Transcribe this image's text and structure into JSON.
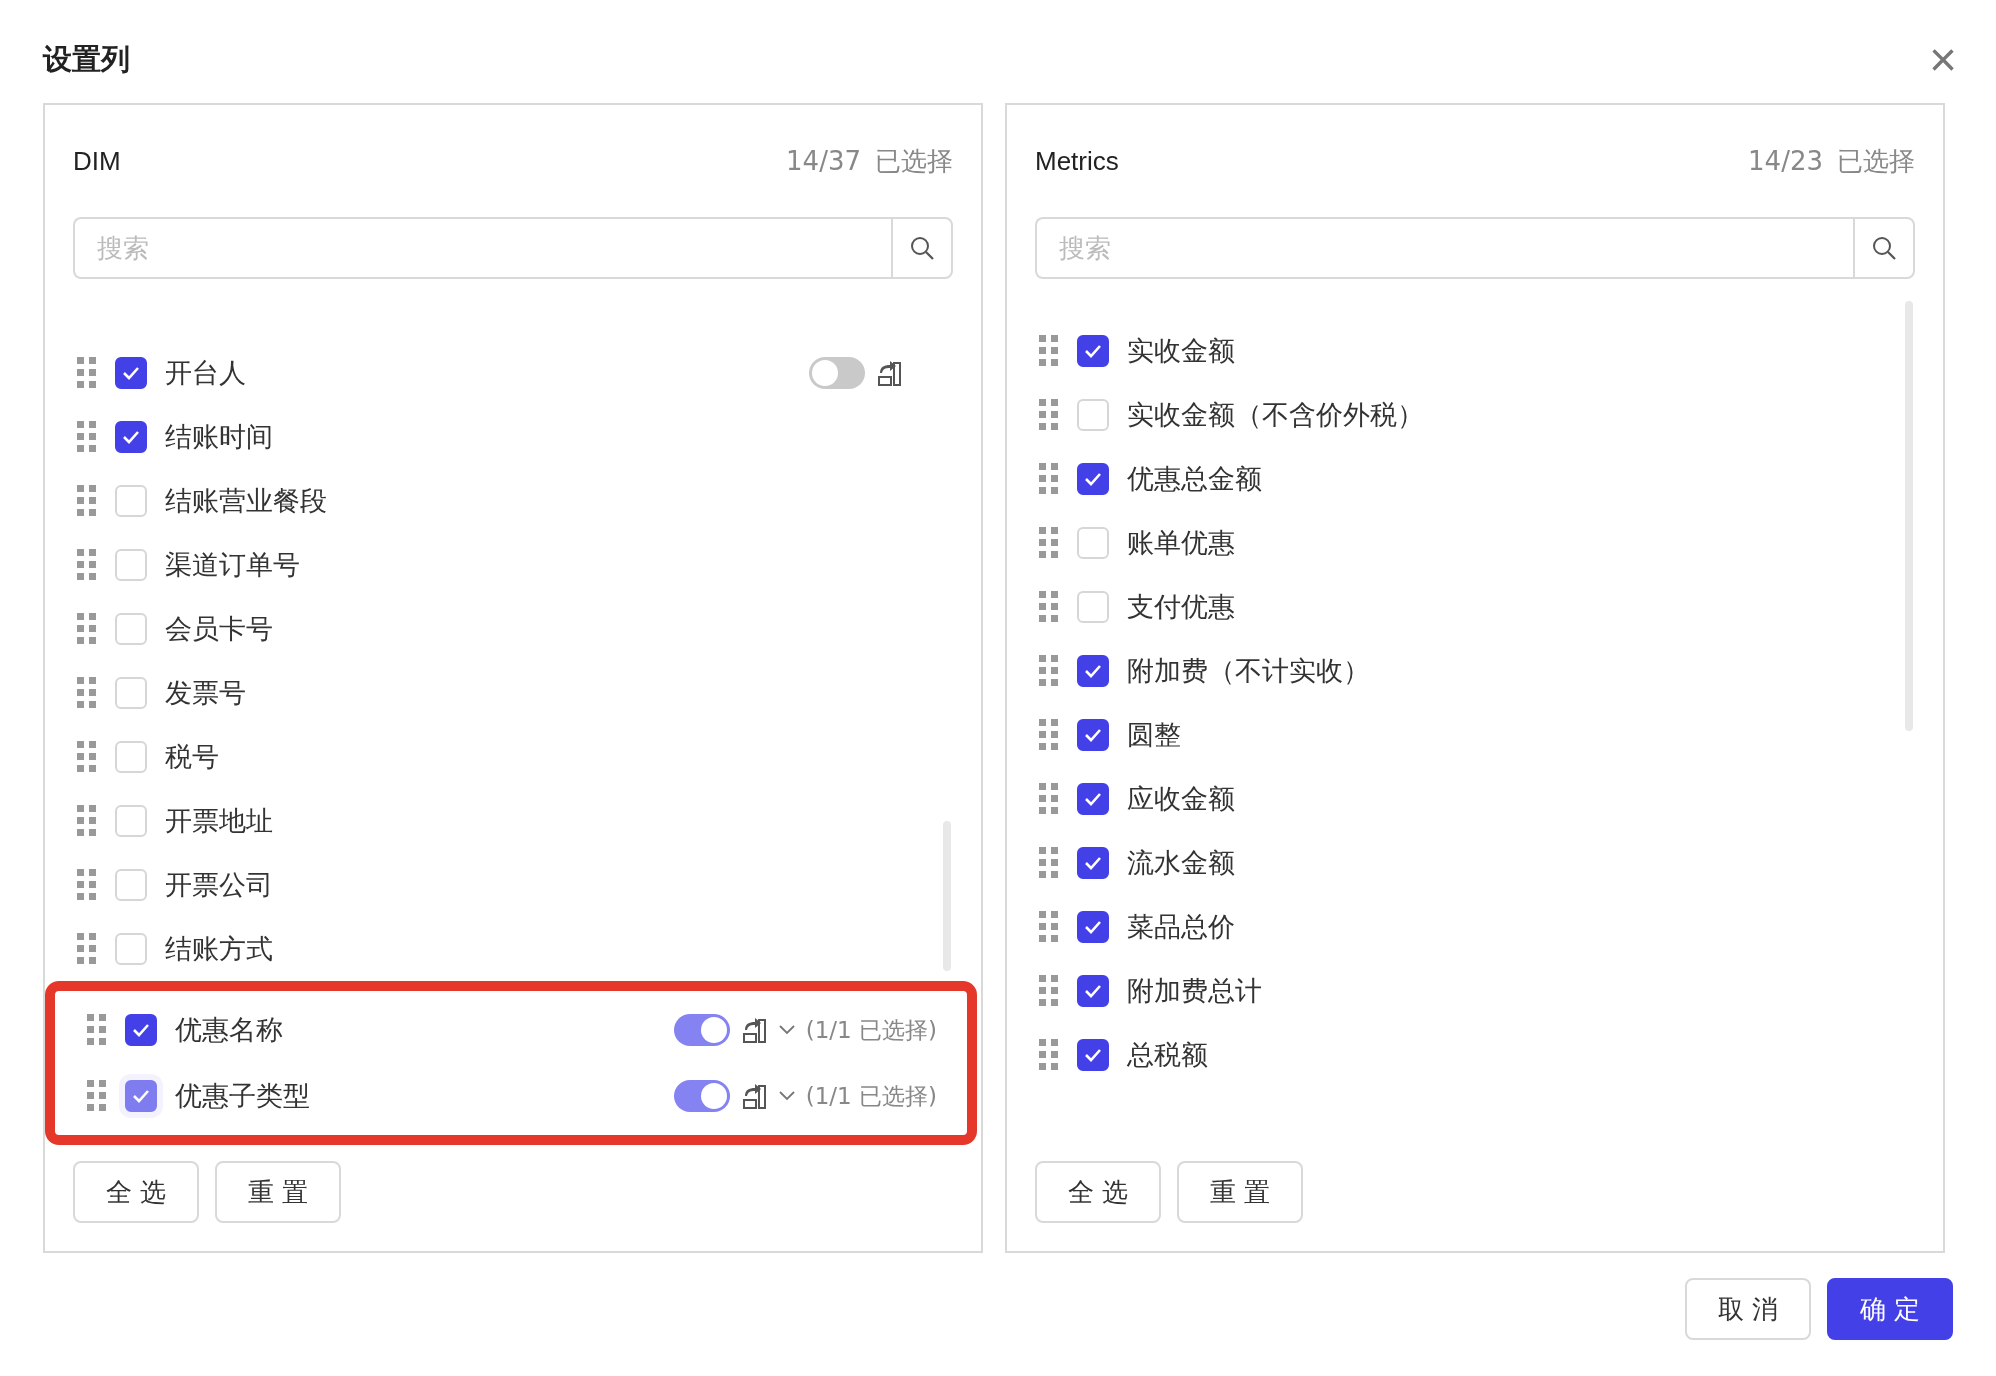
{
  "dialog": {
    "title": "设置列",
    "close": "×"
  },
  "panels": [
    {
      "title": "DIM",
      "count": "14/37",
      "count_label": "已选择",
      "search": {
        "placeholder": "搜索"
      },
      "items": [
        {
          "label": "开台人",
          "checked": true,
          "disabled": false,
          "toggle": {
            "on": false
          }
        },
        {
          "label": "结账时间",
          "checked": true,
          "disabled": false
        },
        {
          "label": "结账营业餐段",
          "checked": false,
          "disabled": false
        },
        {
          "label": "渠道订单号",
          "checked": false,
          "disabled": false
        },
        {
          "label": "会员卡号",
          "checked": false,
          "disabled": false
        },
        {
          "label": "发票号",
          "checked": false,
          "disabled": false
        },
        {
          "label": "税号",
          "checked": false,
          "disabled": false
        },
        {
          "label": "开票地址",
          "checked": false,
          "disabled": false
        },
        {
          "label": "开票公司",
          "checked": false,
          "disabled": false
        },
        {
          "label": "结账方式",
          "checked": false,
          "disabled": false
        }
      ],
      "highlighted_items": [
        {
          "label": "优惠名称",
          "checked": true,
          "disabled": false,
          "toggle": {
            "on": true
          },
          "sub_count": "(1/1 已选择)"
        },
        {
          "label": "优惠子类型",
          "checked": true,
          "disabled": true,
          "toggle": {
            "on": true
          },
          "sub_count": "(1/1 已选择)"
        }
      ],
      "buttons": [
        "全 选",
        "重 置"
      ]
    },
    {
      "title": "Metrics",
      "count": "14/23",
      "count_label": "已选择",
      "search": {
        "placeholder": "搜索"
      },
      "items": [
        {
          "label": "实收金额",
          "checked": true,
          "disabled": false
        },
        {
          "label": "实收金额（不含价外税）",
          "checked": false,
          "disabled": false
        },
        {
          "label": "优惠总金额",
          "checked": true,
          "disabled": false
        },
        {
          "label": "账单优惠",
          "checked": false,
          "disabled": false
        },
        {
          "label": "支付优惠",
          "checked": false,
          "disabled": false
        },
        {
          "label": "附加费（不计实收）",
          "checked": true,
          "disabled": false
        },
        {
          "label": "圆整",
          "checked": true,
          "disabled": false
        },
        {
          "label": "应收金额",
          "checked": true,
          "disabled": false
        },
        {
          "label": "流水金额",
          "checked": true,
          "disabled": false
        },
        {
          "label": "菜品总价",
          "checked": true,
          "disabled": false
        },
        {
          "label": "附加费总计",
          "checked": true,
          "disabled": false
        },
        {
          "label": "总税额",
          "checked": true,
          "disabled": false
        }
      ],
      "buttons": [
        "全 选",
        "重 置"
      ]
    }
  ],
  "footer_buttons": [
    {
      "label": "取 消",
      "kind": "default"
    },
    {
      "label": "确 定",
      "kind": "primary"
    }
  ]
}
